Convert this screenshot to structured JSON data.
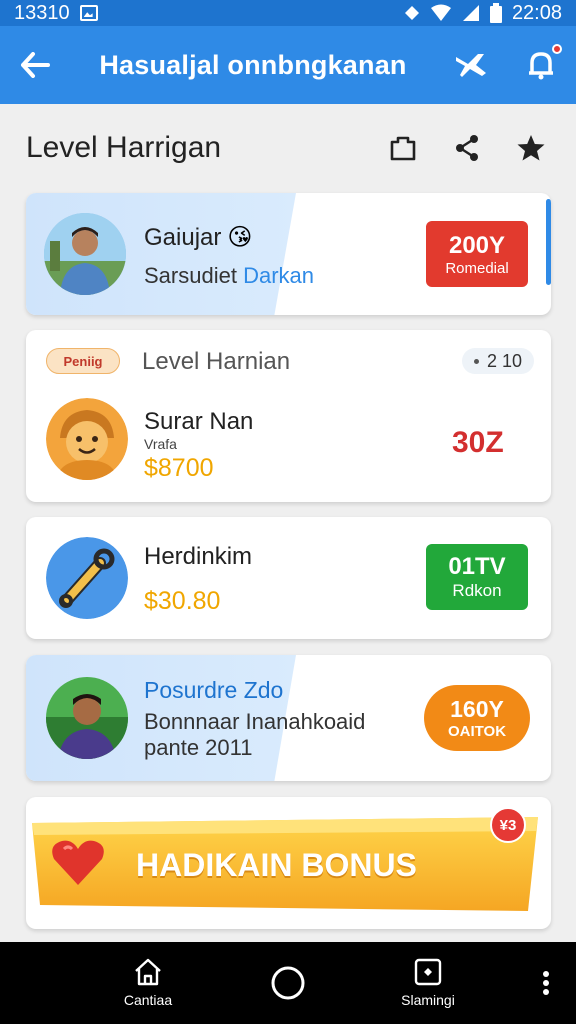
{
  "status_bar": {
    "time_left": "13310",
    "time_right": "22:08"
  },
  "app_bar": {
    "title": "Hasualjal onnbngkanan"
  },
  "header": {
    "title": "Level Harrigan"
  },
  "cards": [
    {
      "name": "Gaiujar",
      "emoji": "😘",
      "subtitle_a": "Sarsudiet",
      "subtitle_b": "Darkan",
      "badge_value": "200Y",
      "badge_label": "Romedial",
      "badge_color": "#e23a2e"
    },
    {
      "tag": "Peniig",
      "level": "Level Harnian",
      "meta": "2 10",
      "name": "Surar Nan",
      "small": "Vrafa",
      "money": "$8700",
      "value": "30Z",
      "value_color": "#d32f2f"
    },
    {
      "name": "Herdinkim",
      "money": "$30.80",
      "badge_value": "01TV",
      "badge_label": "Rdkon",
      "badge_color": "#22a83a"
    },
    {
      "name": "Posurdre Zdo",
      "line1": "Bonnnaar Inanahkoaid",
      "line2": "pante 2011",
      "badge_value": "160Y",
      "badge_label": "OAITOK",
      "badge_color": "#f28a16"
    }
  ],
  "bonus": {
    "label": "HADIKAIN BONUS",
    "badge": "¥3"
  },
  "bottom_nav": {
    "left_label": "Cantiaa",
    "right_label": "Slamingi"
  },
  "colors": {
    "primary": "#2f8ae6",
    "status": "#1e74cf",
    "gold": "#f0a600"
  }
}
